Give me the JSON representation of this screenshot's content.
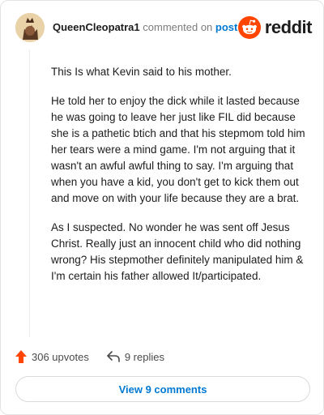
{
  "comment": {
    "author": "QueenCleopatra1",
    "action_text": "commented on",
    "post_link_text": "post",
    "paragraphs": [
      "This Is what Kevin said to his mother.",
      "He told her to enjoy the dick while it lasted because he was going to leave her just like FIL did because she is a pathetic btich and that his stepmom told him her tears were a mind game. I'm not arguing that it wasn't an awful awful thing to say. I'm arguing that when you have a kid, you don't get to kick them out and move on with your life because they are a brat.",
      "As I suspected. No wonder he was sent off Jesus Christ. Really just an innocent child who did nothing wrong? His stepmother definitely manipulated him & I'm certain his father allowed It/participated."
    ],
    "upvotes_text": "306 upvotes",
    "replies_text": "9 replies",
    "view_comments_label": "View 9 comments"
  },
  "brand": {
    "logo_text": "reddit",
    "logo_icon": "reddit-snoo-icon",
    "accent_color": "#ff4500",
    "link_color": "#0079d3"
  },
  "icons": {
    "upvote": "upvote-arrow-icon",
    "reply": "reply-arrow-icon",
    "avatar": "user-avatar"
  }
}
